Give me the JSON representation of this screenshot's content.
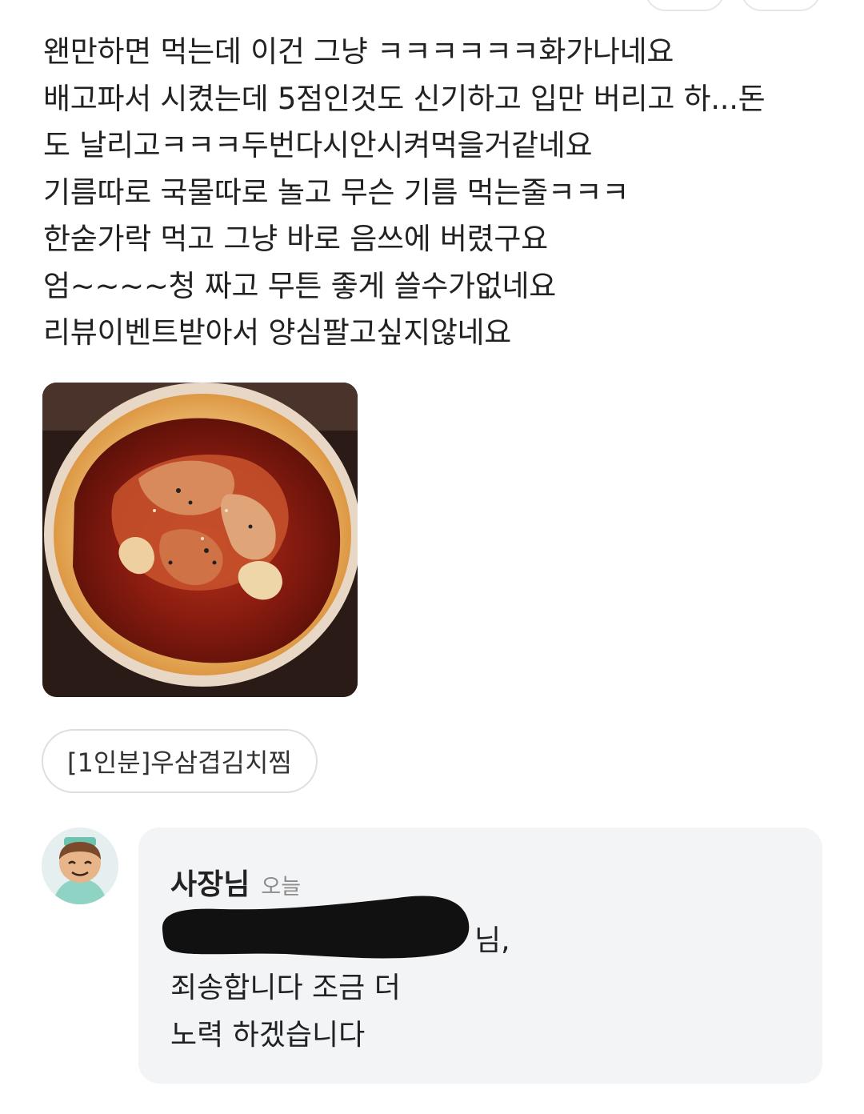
{
  "review": {
    "lines": [
      "왠만하면 먹는데 이건 그냥 ㅋㅋㅋㅋㅋㅋ화가나네요",
      "배고파서 시켰는데 5점인것도 신기하고 입만 버리고 하...돈",
      "도 날리고ㅋㅋㅋ두번다시안시켜먹을거같네요",
      "기름따로 국물따로 놀고 무슨 기름 먹는줄ㅋㅋㅋ",
      "한숟가락 먹고 그냥 바로 음쓰에 버렸구요",
      "엄~~~~청 짜고 무튼 좋게 쓸수가없네요",
      "리뷰이벤트받아서 양심팔고싶지않네요"
    ],
    "photo_icon": "food-photo-kimchi-stew",
    "menu_item": "[1인분]우삼겹김치찜"
  },
  "reply": {
    "author": "사장님",
    "time": "오늘",
    "lines": [
      "님,",
      "죄송합니다 조금 더",
      "노력 하겠습니다"
    ],
    "avatar_icon": "owner-avatar-icon"
  },
  "colors": {
    "text": "#222222",
    "muted": "#8c8c8c",
    "reply_bg": "#f3f4f6",
    "chip_border": "#dedede",
    "redaction": "#111111"
  }
}
